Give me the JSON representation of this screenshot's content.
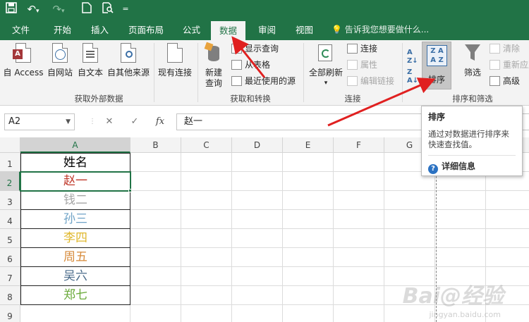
{
  "ribbon_tabs": [
    {
      "label": "文件"
    },
    {
      "label": "开始"
    },
    {
      "label": "插入"
    },
    {
      "label": "页面布局"
    },
    {
      "label": "公式"
    },
    {
      "label": "数据",
      "active": true
    },
    {
      "label": "审阅"
    },
    {
      "label": "视图"
    }
  ],
  "tell_me": "告诉我您想要做什么...",
  "groups": {
    "external": {
      "label": "获取外部数据",
      "buttons": [
        "自 Access",
        "自网站",
        "自文本",
        "自其他来源",
        "现有连接"
      ]
    },
    "transform": {
      "label": "获取和转换",
      "new_query_1": "新建",
      "new_query_2": "查询",
      "items": [
        "显示查询",
        "从表格",
        "最近使用的源"
      ]
    },
    "connections": {
      "label": "连接",
      "refresh_all": "全部刷新",
      "items": [
        "连接",
        "属性",
        "编辑链接"
      ]
    },
    "sort_filter": {
      "label": "排序和筛选",
      "sort": "排序",
      "filter": "筛选",
      "items": [
        "清除",
        "重新应用",
        "高级"
      ]
    }
  },
  "formula_bar": {
    "name_box": "A2",
    "fx": "fx",
    "value": "赵一"
  },
  "columns": [
    "A",
    "B",
    "C",
    "D",
    "E",
    "F",
    "G"
  ],
  "rows": [
    "1",
    "2",
    "3",
    "4",
    "5",
    "6",
    "7",
    "8",
    "9"
  ],
  "cells": [
    {
      "text": "姓名",
      "color": "#000000"
    },
    {
      "text": "赵一",
      "color": "#c0392b"
    },
    {
      "text": "钱二",
      "color": "#a6a6a6"
    },
    {
      "text": "孙三",
      "color": "#6fa3c7"
    },
    {
      "text": "李四",
      "color": "#e0b82e"
    },
    {
      "text": "周五",
      "color": "#d68a3a"
    },
    {
      "text": "吴六",
      "color": "#4a6b8a"
    },
    {
      "text": "郑七",
      "color": "#6aaa3a"
    }
  ],
  "tooltip": {
    "title": "排序",
    "body": "通过对数据进行排序来快速查找值。",
    "help": "详细信息"
  },
  "watermark": "Bai@经验",
  "watermark_sub": "jingyan.baidu.com",
  "colors": {
    "accent": "#217346",
    "annotation": "#e02020"
  }
}
